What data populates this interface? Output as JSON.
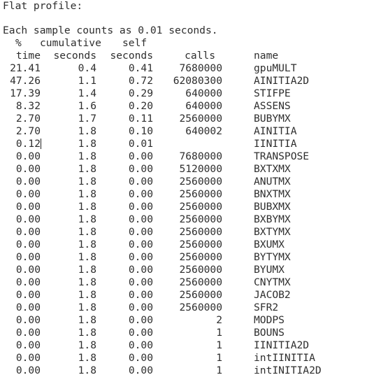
{
  "title": "Flat profile:",
  "note": "Each sample counts as 0.01 seconds.",
  "header": {
    "line1": {
      "time": "%",
      "cumulative": "cumulative",
      "self": "self"
    },
    "line2": {
      "time": "time",
      "cumulative": "seconds",
      "self": "seconds",
      "calls": "calls",
      "name": "name"
    }
  },
  "rows": [
    {
      "time": "21.41",
      "cumulative": "0.4",
      "self": "0.41",
      "calls": "7680000",
      "name": "gpuMULT"
    },
    {
      "time": "47.26",
      "cumulative": "1.1",
      "self": "0.72",
      "calls": "62080300",
      "name": "AINITIA2D"
    },
    {
      "time": "17.39",
      "cumulative": "1.4",
      "self": "0.29",
      "calls": "640000",
      "name": "STIFPE"
    },
    {
      "time": "8.32",
      "cumulative": "1.6",
      "self": "0.20",
      "calls": "640000",
      "name": "ASSENS"
    },
    {
      "time": "2.70",
      "cumulative": "1.7",
      "self": "0.11",
      "calls": "2560000",
      "name": "BUBYMX"
    },
    {
      "time": "2.70",
      "cumulative": "1.8",
      "self": "0.10",
      "calls": "640002",
      "name": "AINITIA"
    },
    {
      "time": "0.12",
      "cumulative": "1.8",
      "self": "0.01",
      "calls": "",
      "name": "IINITIA"
    },
    {
      "time": "0.00",
      "cumulative": "1.8",
      "self": "0.00",
      "calls": "7680000",
      "name": "TRANSPOSE"
    },
    {
      "time": "0.00",
      "cumulative": "1.8",
      "self": "0.00",
      "calls": "5120000",
      "name": "BXTXMX"
    },
    {
      "time": "0.00",
      "cumulative": "1.8",
      "self": "0.00",
      "calls": "2560000",
      "name": "ANUTMX"
    },
    {
      "time": "0.00",
      "cumulative": "1.8",
      "self": "0.00",
      "calls": "2560000",
      "name": "BNXTMX"
    },
    {
      "time": "0.00",
      "cumulative": "1.8",
      "self": "0.00",
      "calls": "2560000",
      "name": "BUBXMX"
    },
    {
      "time": "0.00",
      "cumulative": "1.8",
      "self": "0.00",
      "calls": "2560000",
      "name": "BXBYMX"
    },
    {
      "time": "0.00",
      "cumulative": "1.8",
      "self": "0.00",
      "calls": "2560000",
      "name": "BXTYMX"
    },
    {
      "time": "0.00",
      "cumulative": "1.8",
      "self": "0.00",
      "calls": "2560000",
      "name": "BXUMX"
    },
    {
      "time": "0.00",
      "cumulative": "1.8",
      "self": "0.00",
      "calls": "2560000",
      "name": "BYTYMX"
    },
    {
      "time": "0.00",
      "cumulative": "1.8",
      "self": "0.00",
      "calls": "2560000",
      "name": "BYUMX"
    },
    {
      "time": "0.00",
      "cumulative": "1.8",
      "self": "0.00",
      "calls": "2560000",
      "name": "CNYTMX"
    },
    {
      "time": "0.00",
      "cumulative": "1.8",
      "self": "0.00",
      "calls": "2560000",
      "name": "JACOB2"
    },
    {
      "time": "0.00",
      "cumulative": "1.8",
      "self": "0.00",
      "calls": "2560000",
      "name": "SFR2"
    },
    {
      "time": "0.00",
      "cumulative": "1.8",
      "self": "0.00",
      "calls": "2",
      "name": "MODPS"
    },
    {
      "time": "0.00",
      "cumulative": "1.8",
      "self": "0.00",
      "calls": "1",
      "name": "BOUNS"
    },
    {
      "time": "0.00",
      "cumulative": "1.8",
      "self": "0.00",
      "calls": "1",
      "name": "IINITIA2D"
    },
    {
      "time": "0.00",
      "cumulative": "1.8",
      "self": "0.00",
      "calls": "1",
      "name": "intIINITIA"
    },
    {
      "time": "0.00",
      "cumulative": "1.8",
      "self": "0.00",
      "calls": "1",
      "name": "intINITIA2D"
    }
  ]
}
